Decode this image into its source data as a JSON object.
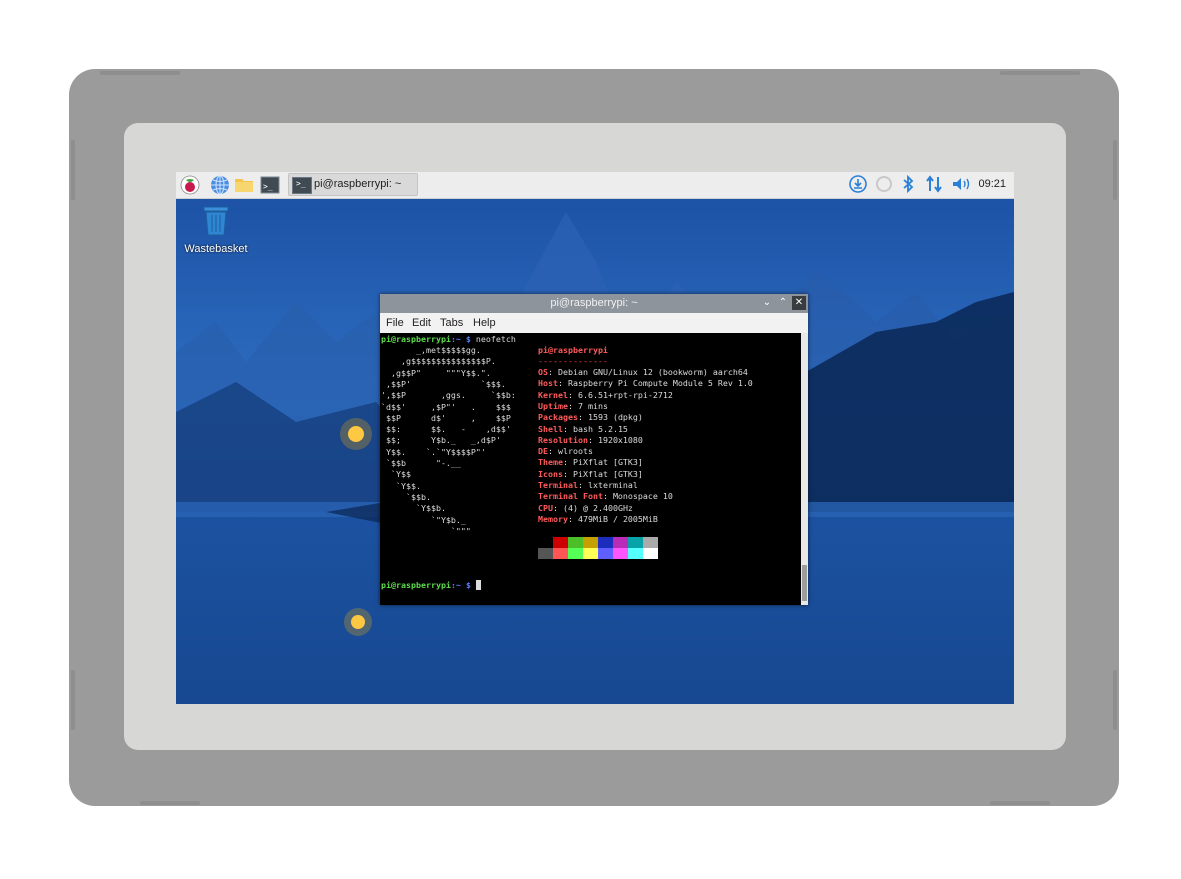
{
  "taskbar": {
    "launch_icons": [
      "raspberry-menu-icon",
      "browser-globe-icon",
      "file-manager-folder-icon",
      "terminal-icon"
    ],
    "task_label": "pi@raspberrypi: ~",
    "tray_icons": [
      "download-icon",
      "sync-icon",
      "bluetooth-icon",
      "network-arrows-icon",
      "volume-icon"
    ],
    "clock": "09:21"
  },
  "desktop": {
    "wastebasket_label": "Wastebasket"
  },
  "terminal": {
    "title": "pi@raspberrypi: ~",
    "menu": [
      "File",
      "Edit",
      "Tabs",
      "Help"
    ],
    "prompt_user": "pi@raspberrypi",
    "prompt_sep": ":~ $ ",
    "command": "neofetch",
    "logo_lines": [
      "       _,met$$$$$gg.",
      "    ,g$$$$$$$$$$$$$$$P.",
      "  ,g$$P\"     \"\"\"Y$$.\".",
      " ,$$P'              `$$$.",
      "',$$P       ,ggs.     `$$b:",
      "`d$$'     ,$P\"'   .    $$$",
      " $$P      d$'     ,    $$P",
      " $$:      $$.   -    ,d$$'",
      " $$;      Y$b._   _,d$P'",
      " Y$$.    `.`\"Y$$$$P\"'",
      " `$$b      \"-.__",
      "  `Y$$",
      "   `Y$$.",
      "     `$$b.",
      "       `Y$$b.",
      "          `\"Y$b._",
      "              `\"\"\""
    ],
    "info_header": "pi@raspberrypi",
    "info_rule": "--------------",
    "info": [
      {
        "key": "OS",
        "value": "Debian GNU/Linux 12 (bookworm) aarch64"
      },
      {
        "key": "Host",
        "value": "Raspberry Pi Compute Module 5 Rev 1.0"
      },
      {
        "key": "Kernel",
        "value": "6.6.51+rpt-rpi-2712"
      },
      {
        "key": "Uptime",
        "value": "7 mins"
      },
      {
        "key": "Packages",
        "value": "1593 (dpkg)"
      },
      {
        "key": "Shell",
        "value": "bash 5.2.15"
      },
      {
        "key": "Resolution",
        "value": "1920x1080"
      },
      {
        "key": "DE",
        "value": "wlroots"
      },
      {
        "key": "Theme",
        "value": "PiXflat [GTK3]"
      },
      {
        "key": "Icons",
        "value": "PiXflat [GTK3]"
      },
      {
        "key": "Terminal",
        "value": "lxterminal"
      },
      {
        "key": "Terminal Font",
        "value": "Monospace 10"
      },
      {
        "key": "CPU",
        "value": "(4) @ 2.400GHz"
      },
      {
        "key": "Memory",
        "value": "479MiB / 2005MiB"
      }
    ],
    "palette_row1": [
      "#000000",
      "#cc0000",
      "#4bbe28",
      "#c4a000",
      "#1c2dbd",
      "#b82cb8",
      "#06a3a9",
      "#aaaaaa"
    ],
    "palette_row2": [
      "#555555",
      "#ff5555",
      "#55ff55",
      "#ffff55",
      "#5f5fff",
      "#ff55ff",
      "#55ffff",
      "#ffffff"
    ],
    "final_prompt_user": "pi@raspberrypi",
    "final_prompt_sep": ":~ $ "
  }
}
